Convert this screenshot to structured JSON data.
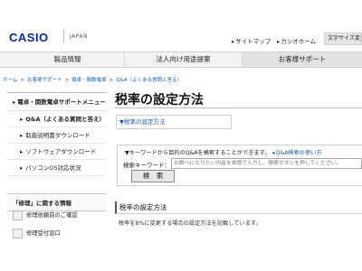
{
  "header": {
    "logo": "CASIO",
    "region": "JAPAN",
    "links": [
      {
        "label": "サイトマップ"
      },
      {
        "label": "カシオホーム"
      }
    ],
    "font_size_label": "文字サイズ変更"
  },
  "global_nav": {
    "items": [
      {
        "label": "製品情報"
      },
      {
        "label": "法人向け用途提案"
      },
      {
        "label": "お客様サポート",
        "active": true
      }
    ]
  },
  "breadcrumb": [
    "ホーム",
    "お客様サポート",
    "電卓・関数電卓",
    "Q&A（よくある質問と答え）"
  ],
  "sidebar": {
    "heading": "電卓・関数電卓サポートメニュー",
    "items": [
      {
        "label": "Q&A（よくある質問と答え）",
        "active": true
      },
      {
        "label": "取扱説明書ダウンロード"
      },
      {
        "label": "ソフトウェアダウンロード"
      },
      {
        "label": "パソコンOS対応状況"
      }
    ],
    "repair_title": "「修理」に関する情報",
    "repair_links": [
      {
        "label": "修理依頼前のご確認",
        "icon": "wrench-icon"
      },
      {
        "label": "修理受付窓口",
        "icon": "phone-icon"
      }
    ]
  },
  "main": {
    "title": "税率の設定方法",
    "toc_link": "税率の設定方法",
    "search": {
      "guide": "▼キーワードから目的のQ&Aを検索することができます。",
      "qa_link": "Q&A検索の使い方",
      "keyword_label": "検索キーワード：",
      "placeholder": "お調べになりたい内容を単語で入力し、検索ボタンを押してください。",
      "button": "検　索"
    },
    "section_title": "税率の設定方法",
    "section_desc": "税率を8%に変更する場合の設定方法を記載しています。"
  },
  "colors": {
    "logo": "#0a2a8c",
    "link": "#1a5aa8",
    "nav_bg": "#f3f3f3"
  }
}
